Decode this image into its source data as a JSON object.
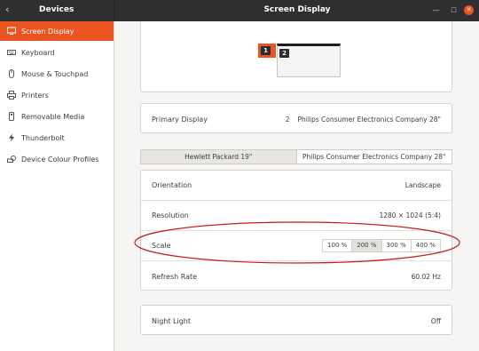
{
  "titlebar": {
    "left_title": "Devices",
    "center_title": "Screen Display",
    "back_glyph": "‹",
    "min_glyph": "—",
    "max_glyph": "□",
    "close_glyph": "✕"
  },
  "sidebar": {
    "items": [
      {
        "label": "Screen Display",
        "icon": "display-icon",
        "active": true
      },
      {
        "label": "Keyboard",
        "icon": "keyboard-icon",
        "active": false
      },
      {
        "label": "Mouse & Touchpad",
        "icon": "mouse-icon",
        "active": false
      },
      {
        "label": "Printers",
        "icon": "printer-icon",
        "active": false
      },
      {
        "label": "Removable Media",
        "icon": "media-icon",
        "active": false
      },
      {
        "label": "Thunderbolt",
        "icon": "thunderbolt-icon",
        "active": false
      },
      {
        "label": "Device Colour Profiles",
        "icon": "colour-profile-icon",
        "active": false
      }
    ]
  },
  "arrangement": {
    "monitor_1_label": "1",
    "monitor_2_label": "2"
  },
  "primary_display": {
    "label": "Primary Display",
    "number": "2",
    "name": "Philips Consumer Electronics Company 28\""
  },
  "monitor_tabs": [
    {
      "label": "Hewlett Packard 19\"",
      "active": true
    },
    {
      "label": "Philips Consumer Electronics Company 28\"",
      "active": false
    }
  ],
  "settings": {
    "orientation": {
      "label": "Orientation",
      "value": "Landscape"
    },
    "resolution": {
      "label": "Resolution",
      "value": "1280 × 1024 (5:4)"
    },
    "scale": {
      "label": "Scale",
      "options": [
        "100 %",
        "200 %",
        "300 %",
        "400 %"
      ],
      "selected": "200 %"
    },
    "refresh_rate": {
      "label": "Refresh Rate",
      "value": "60.02 Hz"
    }
  },
  "night_light": {
    "label": "Night Light",
    "value": "Off"
  },
  "colors": {
    "accent": "#e95420",
    "annotation": "#c41a1a",
    "titlebar": "#2f2f2f"
  }
}
